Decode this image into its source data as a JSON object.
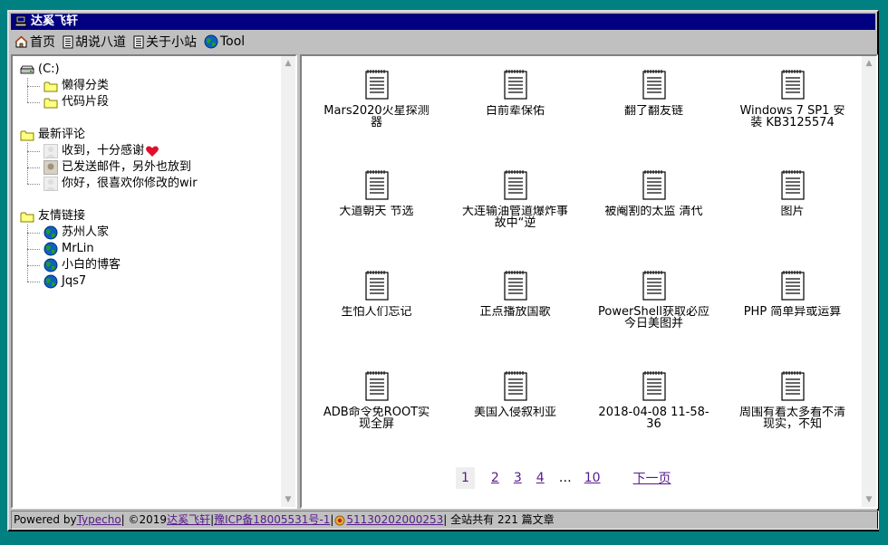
{
  "window": {
    "title": "达奚飞轩"
  },
  "menu": [
    {
      "label": "首页",
      "icon": "home-icon"
    },
    {
      "label": "胡说八道",
      "icon": "document-icon"
    },
    {
      "label": "关于小站",
      "icon": "document-icon"
    },
    {
      "label": "Tool",
      "icon": "globe-icon"
    }
  ],
  "tree": {
    "drive": {
      "label": "(C:)",
      "children": [
        "懒得分类",
        "代码片段"
      ]
    },
    "comments": {
      "label": "最新评论",
      "children": [
        "收到，十分感谢",
        "已发送邮件，另外也放到",
        "你好，很喜欢你修改的wir"
      ]
    },
    "links": {
      "label": "友情链接",
      "children": [
        "苏州人家",
        "MrLin",
        "小白的博客",
        "Jqs7"
      ]
    }
  },
  "posts": [
    "Mars2020火星探测器",
    "白前辈保佑",
    "翻了翻友链",
    "Windows 7 SP1 安装 KB3125574",
    "大道朝天 节选",
    "大连输油管道爆炸事故中“逆",
    "被阉割的太监 清代",
    "图片",
    "生怕人们忘记",
    "正点播放国歌",
    "PowerShell获取必应今日美图并",
    "PHP 简单异或运算",
    "ADB命令免ROOT实现全屏",
    "美国入侵叙利亚",
    "2018-04-08 11-58-36",
    "周围有着太多看不清现实，不知"
  ],
  "pager": {
    "current": "1",
    "pages": [
      "2",
      "3",
      "4"
    ],
    "dots": "…",
    "last": "10",
    "next": "下一页"
  },
  "status": {
    "powered": "Powered by ",
    "typecho": "Typecho",
    "sep1": " | ©2019 ",
    "site": "达奚飞轩",
    "sep2": " | ",
    "icp": "豫ICP备18005531号-1",
    "sep3": " | ",
    "police": "51130202000253",
    "sep4": " | 全站共有 221 篇文章"
  }
}
